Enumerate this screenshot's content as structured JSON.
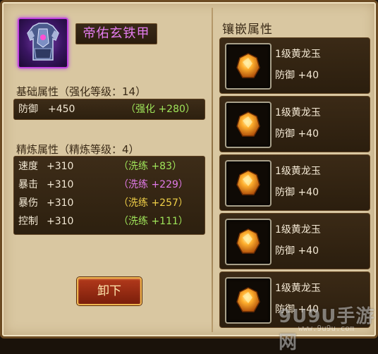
{
  "item": {
    "name": "帝佑玄铁甲",
    "icon": "armor-icon"
  },
  "base": {
    "title": "基础属性（强化等级：14）",
    "rows": [
      {
        "name": "防御",
        "value": "+450",
        "bonus": "（强化 +280）",
        "bonus_color": "#9fe55a"
      }
    ]
  },
  "refine": {
    "title": "精炼属性（精炼等级：4）",
    "rows": [
      {
        "name": "速度",
        "value": "+310",
        "bonus": "（洗练 +83）",
        "bonus_color": "#9fe55a"
      },
      {
        "name": "暴击",
        "value": "+310",
        "bonus": "（洗练 +229）",
        "bonus_color": "#e07ae8"
      },
      {
        "name": "暴伤",
        "value": "+310",
        "bonus": "（洗练 +257）",
        "bonus_color": "#f0d048"
      },
      {
        "name": "控制",
        "value": "+310",
        "bonus": "（洗练 +111）",
        "bonus_color": "#9fe55a"
      }
    ]
  },
  "unequip_label": "卸下",
  "sockets": {
    "title": "镶嵌属性",
    "gems": [
      {
        "name": "1级黄龙玉",
        "stat": "防御 +40",
        "icon": "gem-icon"
      },
      {
        "name": "1级黄龙玉",
        "stat": "防御 +40",
        "icon": "gem-icon"
      },
      {
        "name": "1级黄龙玉",
        "stat": "防御 +40",
        "icon": "gem-icon"
      },
      {
        "name": "1级黄龙玉",
        "stat": "防御 +40",
        "icon": "gem-icon"
      },
      {
        "name": "1级黄龙玉",
        "stat": "防御 +40",
        "icon": "gem-icon"
      }
    ]
  },
  "watermark": {
    "text": "9U9U手游网",
    "url": "www.9u9u.com"
  }
}
